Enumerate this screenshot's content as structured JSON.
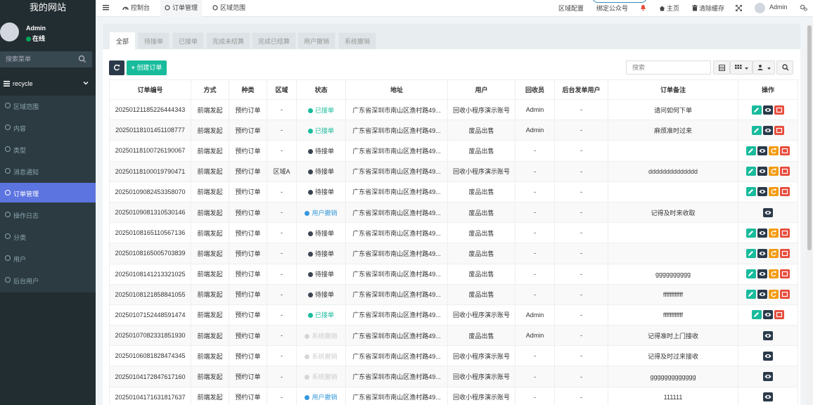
{
  "site": {
    "title": "我的网站"
  },
  "user": {
    "name": "Admin",
    "status": "在线"
  },
  "sidebar": {
    "search_placeholder": "搜索菜单",
    "group": "recycle",
    "items": [
      {
        "label": "区域范围",
        "active": false
      },
      {
        "label": "内容",
        "active": false
      },
      {
        "label": "类型",
        "active": false
      },
      {
        "label": "消息通知",
        "active": false
      },
      {
        "label": "订单管理",
        "active": true
      },
      {
        "label": "操作日志",
        "active": false
      },
      {
        "label": "分类",
        "active": false
      },
      {
        "label": "用户",
        "active": false
      },
      {
        "label": "后台用户",
        "active": false
      }
    ]
  },
  "topbar": {
    "tabs": [
      {
        "label": "控制台",
        "icon": "dashboard-icon"
      },
      {
        "label": "订单管理",
        "icon": "circle-icon"
      },
      {
        "label": "区域范围",
        "icon": "circle-icon"
      }
    ],
    "right": {
      "region_config": "区域配置",
      "bind_wechat": "绑定公众号",
      "home": "主页",
      "clear_cache": "清除缓存",
      "admin": "Admin"
    }
  },
  "filter_tabs": [
    "全部",
    "待接单",
    "已接单",
    "完成未结算",
    "完成已结算",
    "用户撤销",
    "系统撤销"
  ],
  "toolbar": {
    "create_label": "创建订单",
    "search_placeholder": "搜索"
  },
  "table": {
    "columns": [
      "订单编号",
      "方式",
      "种类",
      "区域",
      "状态",
      "地址",
      "用户",
      "回收员",
      "后台发单用户",
      "订单备注",
      "操作"
    ],
    "rows": [
      {
        "id": "2025012118522644434​3",
        "method": "前端发起",
        "kind": "预约订单",
        "area": "-",
        "status": "已接单",
        "status_type": "green",
        "address": "广东省深圳市南山区渔村路49...",
        "user": "回收小程序演示账号",
        "collector": "Admin",
        "backend_user": "-",
        "remark": "请问如何下单",
        "actions": [
          "edit",
          "view",
          "del"
        ]
      },
      {
        "id": "20250118101451108777",
        "method": "前端发起",
        "kind": "预约订单",
        "area": "-",
        "status": "已接单",
        "status_type": "green",
        "address": "广东省深圳市南山区渔村路49...",
        "user": "废品出售",
        "collector": "Admin",
        "backend_user": "-",
        "remark": "麻烦准时过来",
        "actions": [
          "edit",
          "view",
          "del"
        ]
      },
      {
        "id": "20250118100726190067",
        "method": "前端发起",
        "kind": "预约订单",
        "area": "-",
        "status": "待接单",
        "status_type": "dark",
        "address": "广东省深圳市南山区渔村路49...",
        "user": "废品出售",
        "collector": "-",
        "backend_user": "-",
        "remark": "",
        "actions": [
          "edit",
          "view",
          "sync",
          "del"
        ]
      },
      {
        "id": "20250118100019790471",
        "method": "前端发起",
        "kind": "预约订单",
        "area": "区域A",
        "status": "待接单",
        "status_type": "dark",
        "address": "广东省深圳市南山区渔村路49...",
        "user": "回收小程序演示账号",
        "collector": "-",
        "backend_user": "-",
        "remark": "dddddddddddddd",
        "actions": [
          "edit",
          "view",
          "sync",
          "del"
        ]
      },
      {
        "id": "20250109082453358070",
        "method": "前端发起",
        "kind": "预约订单",
        "area": "-",
        "status": "待接单",
        "status_type": "dark",
        "address": "广东省深圳市南山区渔村路49...",
        "user": "废品出售",
        "collector": "-",
        "backend_user": "-",
        "remark": "",
        "actions": [
          "edit",
          "view",
          "sync",
          "del"
        ]
      },
      {
        "id": "20250109081310530146",
        "method": "前端发起",
        "kind": "预约订单",
        "area": "-",
        "status": "用户撤销",
        "status_type": "blue",
        "address": "广东省深圳市南山区渔村路49...",
        "user": "废品出售",
        "collector": "-",
        "backend_user": "-",
        "remark": "记得及时来收取",
        "actions": [
          "view"
        ]
      },
      {
        "id": "20250108165110567136",
        "method": "前端发起",
        "kind": "预约订单",
        "area": "-",
        "status": "待接单",
        "status_type": "dark",
        "address": "广东省深圳市南山区渔村路49...",
        "user": "废品出售",
        "collector": "-",
        "backend_user": "-",
        "remark": "",
        "actions": [
          "edit",
          "view",
          "sync",
          "del"
        ]
      },
      {
        "id": "20250108165005703839",
        "method": "前端发起",
        "kind": "预约订单",
        "area": "-",
        "status": "待接单",
        "status_type": "dark",
        "address": "广东省深圳市南山区渔村路49...",
        "user": "废品出售",
        "collector": "-",
        "backend_user": "-",
        "remark": "",
        "actions": [
          "edit",
          "view",
          "sync",
          "del"
        ]
      },
      {
        "id": "20250108141213321025",
        "method": "前端发起",
        "kind": "预约订单",
        "area": "-",
        "status": "待接单",
        "status_type": "dark",
        "address": "广东省深圳市南山区渔村路49...",
        "user": "废品出售",
        "collector": "-",
        "backend_user": "-",
        "remark": "gggggggggg",
        "actions": [
          "edit",
          "view",
          "sync",
          "del"
        ]
      },
      {
        "id": "20250108121858841055",
        "method": "前端发起",
        "kind": "预约订单",
        "area": "-",
        "status": "待接单",
        "status_type": "dark",
        "address": "广东省深圳市南山区渔村路49...",
        "user": "废品出售",
        "collector": "-",
        "backend_user": "-",
        "remark": "ffffffffffff",
        "actions": [
          "edit",
          "view",
          "sync",
          "del"
        ]
      },
      {
        "id": "20250107152448591474",
        "method": "前端发起",
        "kind": "预约订单",
        "area": "-",
        "status": "已接单",
        "status_type": "green",
        "address": "广东省深圳市南山区渔村路49...",
        "user": "回收小程序演示账号",
        "collector": "Admin",
        "backend_user": "-",
        "remark": "ffffffffffff",
        "actions": [
          "edit",
          "view",
          "del"
        ]
      },
      {
        "id": "20250107082331851930",
        "method": "前端发起",
        "kind": "预约订单",
        "area": "-",
        "status": "系统撤销",
        "status_type": "gray",
        "address": "广东省深圳市南山区渔村路49...",
        "user": "废品出售",
        "collector": "Admin",
        "backend_user": "-",
        "remark": "记得准时上门接收",
        "actions": [
          "view"
        ]
      },
      {
        "id": "20250106081828474345",
        "method": "前端发起",
        "kind": "预约订单",
        "area": "-",
        "status": "系统撤销",
        "status_type": "gray",
        "address": "广东省深圳市南山区渔村路49...",
        "user": "回收小程序演示账号",
        "collector": "-",
        "backend_user": "-",
        "remark": "记得及时过来接收",
        "actions": [
          "view"
        ]
      },
      {
        "id": "20250104172847617160",
        "method": "前端发起",
        "kind": "预约订单",
        "area": "-",
        "status": "系统撤销",
        "status_type": "gray",
        "address": "广东省深圳市南山区渔村路49...",
        "user": "回收小程序演示账号",
        "collector": "-",
        "backend_user": "-",
        "remark": "ggggggggggggg",
        "actions": [
          "view"
        ]
      },
      {
        "id": "20250104171631817637",
        "method": "前端发起",
        "kind": "预约订单",
        "area": "-",
        "status": "用户撤销",
        "status_type": "blue",
        "address": "广东省深圳市南山区渔村路49...",
        "user": "回收小程序演示账号",
        "collector": "-",
        "backend_user": "-",
        "remark": "111111",
        "actions": [
          "view"
        ]
      }
    ]
  },
  "colors": {
    "accent": "#5c74e0",
    "green": "#18bc9c",
    "dark": "#2b3a4a",
    "orange": "#f39c12",
    "red": "#e74c3c",
    "blue": "#3498db",
    "sidebar": "#222d32"
  }
}
